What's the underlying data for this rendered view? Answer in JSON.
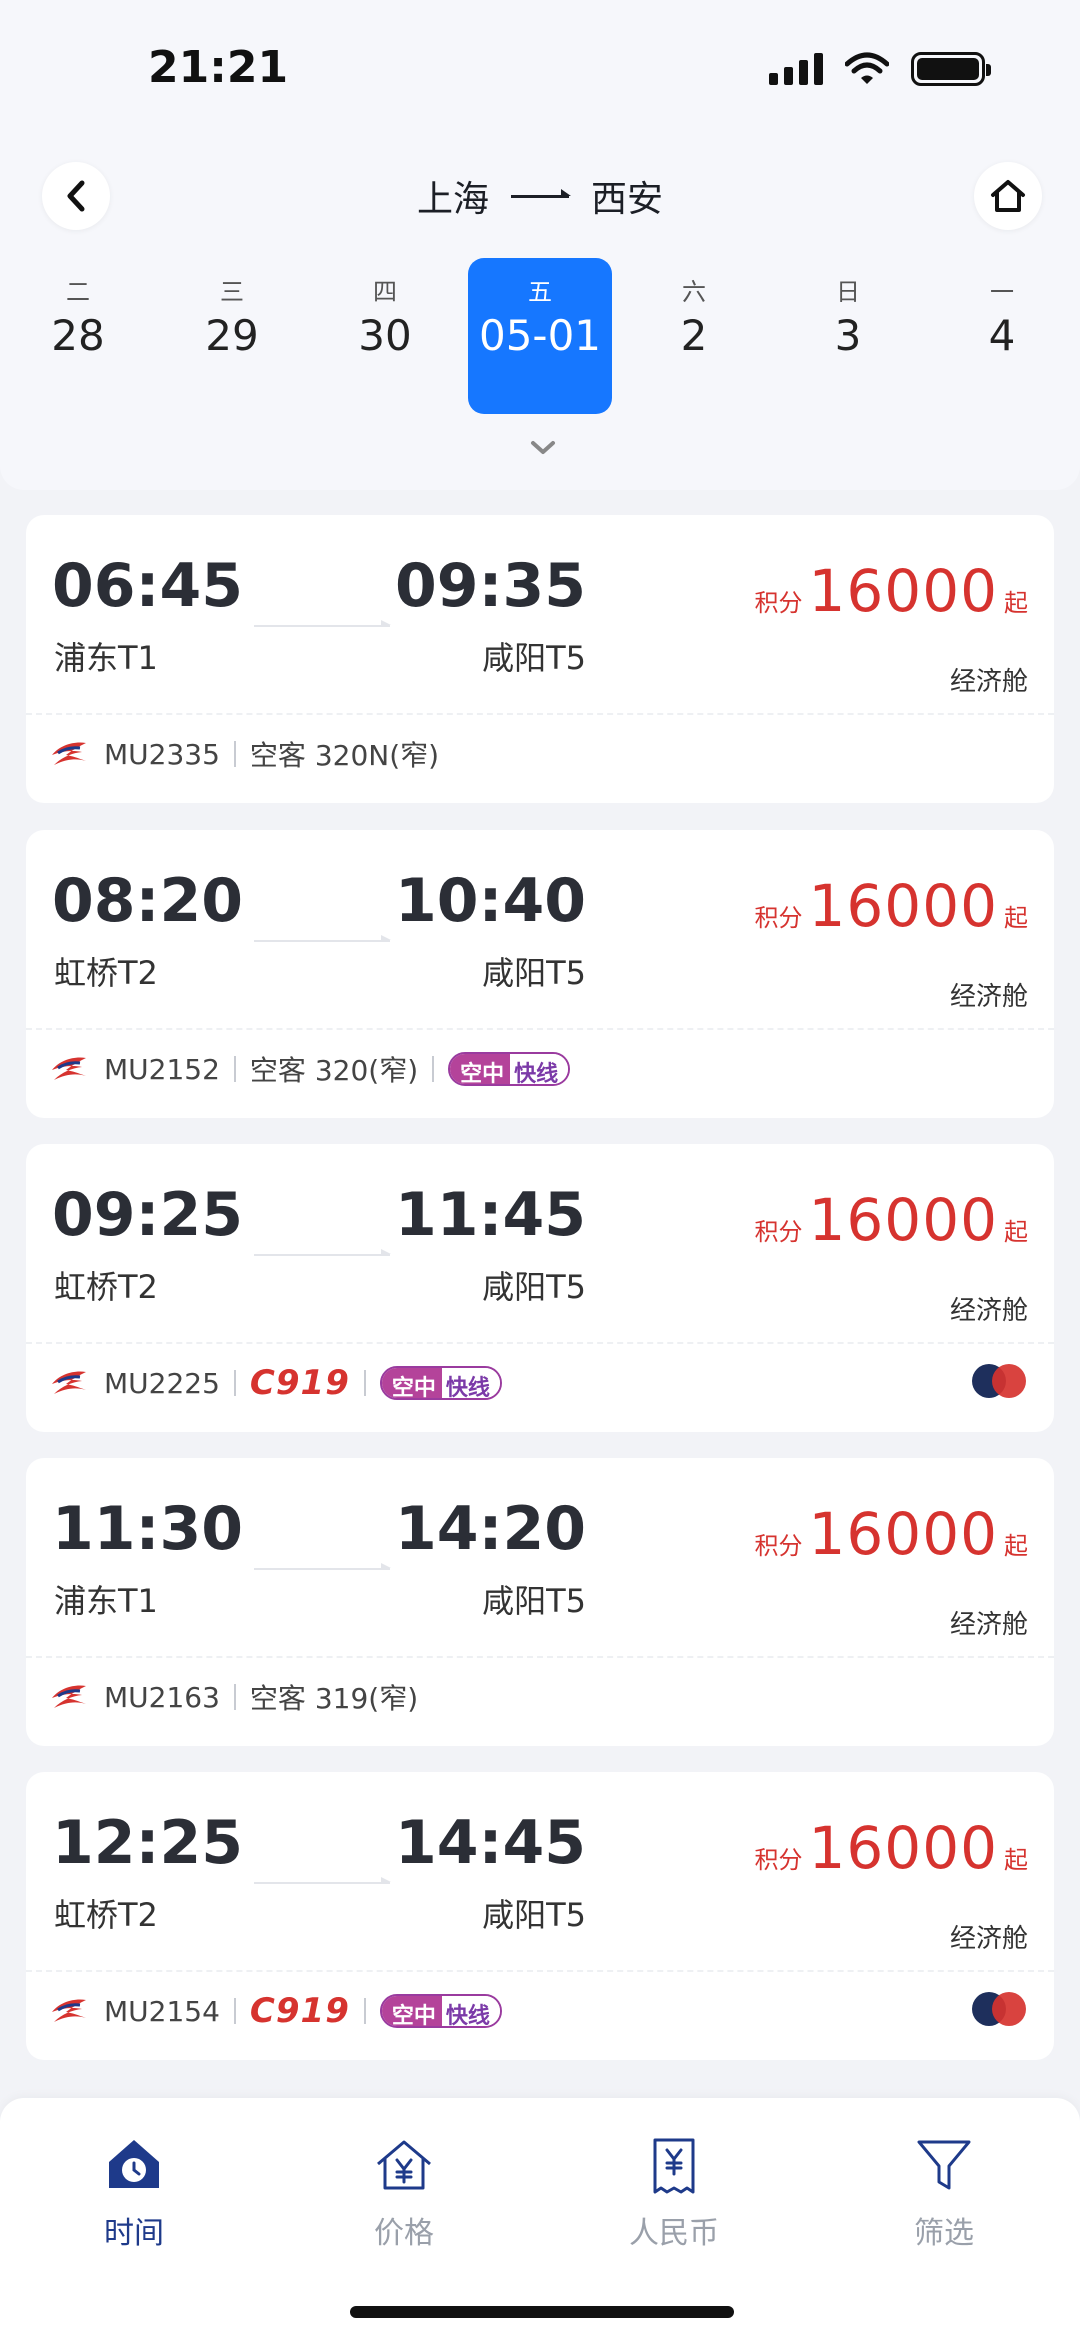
{
  "status": {
    "time": "21:21"
  },
  "header": {
    "from": "上海",
    "to": "西安"
  },
  "dates": [
    {
      "weekday": "二",
      "day": "28",
      "active": false
    },
    {
      "weekday": "三",
      "day": "29",
      "active": false
    },
    {
      "weekday": "四",
      "day": "30",
      "active": false
    },
    {
      "weekday": "五",
      "day": "05-01",
      "active": true
    },
    {
      "weekday": "六",
      "day": "2",
      "active": false
    },
    {
      "weekday": "日",
      "day": "3",
      "active": false
    },
    {
      "weekday": "一",
      "day": "4",
      "active": false
    }
  ],
  "flights": [
    {
      "dep_time": "06:45",
      "arr_time": "09:35",
      "dep_term": "浦东T1",
      "arr_term": "咸阳T5",
      "price_label": "积分",
      "price": "16000",
      "price_suffix": "起",
      "cabin": "经济舱",
      "flight_no": "MU2335",
      "aircraft": "空客 320N(窄)"
    },
    {
      "dep_time": "08:20",
      "arr_time": "10:40",
      "dep_term": "虹桥T2",
      "arr_term": "咸阳T5",
      "price_label": "积分",
      "price": "16000",
      "price_suffix": "起",
      "cabin": "经济舱",
      "flight_no": "MU2152",
      "aircraft": "空客 320(窄)",
      "express_a": "空中",
      "express_b": "快线"
    },
    {
      "dep_time": "09:25",
      "arr_time": "11:45",
      "dep_term": "虹桥T2",
      "arr_term": "咸阳T5",
      "price_label": "积分",
      "price": "16000",
      "price_suffix": "起",
      "cabin": "经济舱",
      "flight_no": "MU2225",
      "aircraft_brand": "C919",
      "express_a": "空中",
      "express_b": "快线"
    },
    {
      "dep_time": "11:30",
      "arr_time": "14:20",
      "dep_term": "浦东T1",
      "arr_term": "咸阳T5",
      "price_label": "积分",
      "price": "16000",
      "price_suffix": "起",
      "cabin": "经济舱",
      "flight_no": "MU2163",
      "aircraft": "空客 319(窄)"
    },
    {
      "dep_time": "12:25",
      "arr_time": "14:45",
      "dep_term": "虹桥T2",
      "arr_term": "咸阳T5",
      "price_label": "积分",
      "price": "16000",
      "price_suffix": "起",
      "cabin": "经济舱",
      "flight_no": "MU2154",
      "aircraft_brand": "C919",
      "express_a": "空中",
      "express_b": "快线"
    }
  ],
  "tabs": [
    {
      "label": "时间",
      "icon": "clock-home-icon",
      "active": true
    },
    {
      "label": "价格",
      "icon": "yen-house-icon",
      "active": false
    },
    {
      "label": "人民币",
      "icon": "yen-receipt-icon",
      "active": false
    },
    {
      "label": "筛选",
      "icon": "filter-icon",
      "active": false
    }
  ],
  "colors": {
    "accent": "#1677ff",
    "price": "#d6332f",
    "tab_active": "#1e3a8a"
  }
}
